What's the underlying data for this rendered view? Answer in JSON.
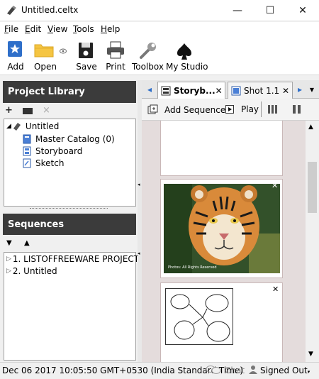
{
  "window": {
    "title": "Untitled.celtx",
    "minimize": "—",
    "maximize": "☐",
    "close": "✕"
  },
  "menu": {
    "items": [
      {
        "u": "F",
        "rest": "ile"
      },
      {
        "u": "E",
        "rest": "dit"
      },
      {
        "u": "V",
        "rest": "iew"
      },
      {
        "u": "T",
        "rest": "ools"
      },
      {
        "u": "H",
        "rest": "elp"
      }
    ]
  },
  "toolbar": {
    "add": "Add",
    "open": "Open",
    "save": "Save",
    "print": "Print",
    "toolbox": "Toolbox",
    "my_studio": "My Studio"
  },
  "project_library": {
    "title": "Project Library",
    "tools": {
      "add": "+",
      "folder": "▬",
      "delete": "×"
    },
    "tree": {
      "root": "Untitled",
      "items": [
        "Master Catalog (0)",
        "Storyboard",
        "Sketch"
      ]
    }
  },
  "sequences": {
    "title": "Sequences",
    "items": [
      "1. LISTOFFREEWARE PROJECT",
      "2. Untitled"
    ]
  },
  "tabs": [
    {
      "label": "Storyb...",
      "close": "✕"
    },
    {
      "label": "Shot 1.1",
      "close": "✕"
    }
  ],
  "sequence_bar": {
    "add_sequence": "Add Sequence",
    "play": "Play"
  },
  "storyboard": {
    "image_caption": "Photos: All Rights Reserved"
  },
  "status": {
    "datetime": "Dec 06 2017 10:05:50 GMT+0530 (India Standard Time)",
    "chat": "Chat",
    "signed_out": "Signed Out"
  },
  "colors": {
    "panel_header": "#3b3b3b",
    "storyboard_bg": "#e4dcdc",
    "accent_blue": "#2f6fc9"
  }
}
